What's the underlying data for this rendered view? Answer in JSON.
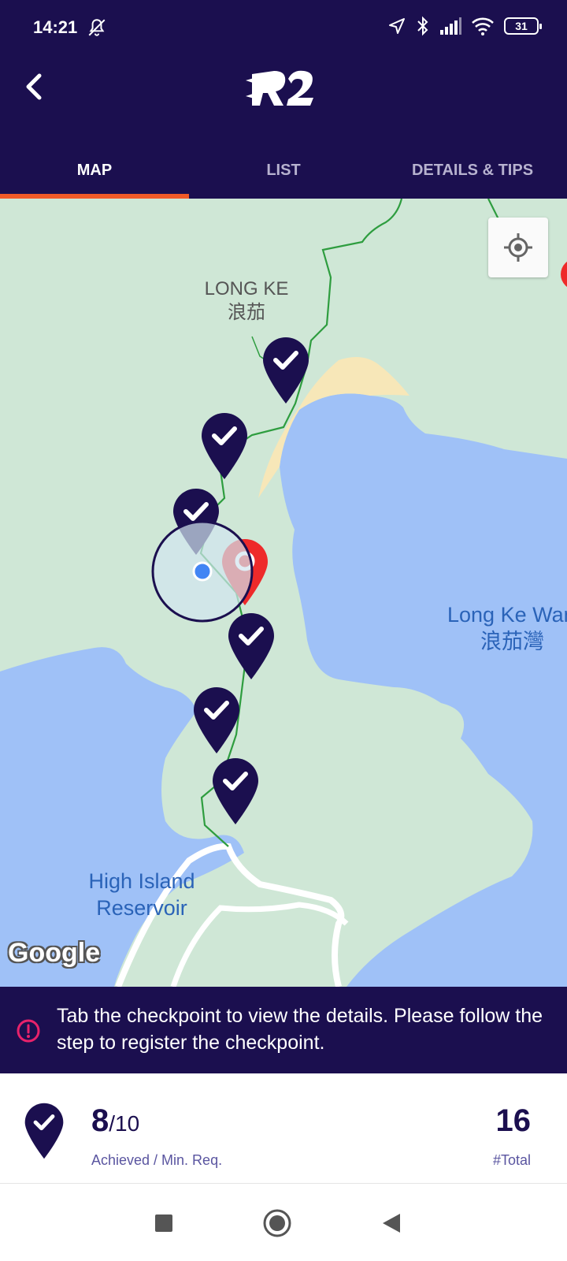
{
  "status_bar": {
    "time": "14:21",
    "battery": "31",
    "icons": [
      "bell-off-icon",
      "location-arrow-icon",
      "bluetooth-icon",
      "signal-icon",
      "wifi-icon",
      "battery-icon"
    ]
  },
  "app_bar": {
    "logo_text": "R2",
    "back_icon": "chevron-left-icon"
  },
  "tabs": [
    {
      "label": "MAP",
      "active": true
    },
    {
      "label": "LIST",
      "active": false
    },
    {
      "label": "DETAILS & TIPS",
      "active": false
    }
  ],
  "map": {
    "labels": {
      "long_ke_en": "LONG KE",
      "long_ke_zh": "浪茄",
      "bay_en": "Long Ke Wan",
      "bay_zh": "浪茄灣",
      "reservoir_line1": "High Island",
      "reservoir_line2": "Reservoir"
    },
    "attribution": "Google",
    "checkpoints_achieved_shown": 6,
    "colors": {
      "land": "#cfe7d6",
      "water": "#9fc1f7",
      "beach": "#f7e7b8",
      "trail": "#2e9d3f",
      "pin": "#1b0f4f",
      "target_pin": "#ee2a2a"
    }
  },
  "banner": {
    "message": "Tab the checkpoint to view the details. Please follow the step to register the checkpoint."
  },
  "summary": {
    "achieved": "8",
    "min_req": "/10",
    "achieved_label": "Achieved / Min. Req.",
    "total": "16",
    "total_label": "#Total"
  },
  "nav": [
    "recent-apps-button",
    "home-button",
    "back-button"
  ]
}
